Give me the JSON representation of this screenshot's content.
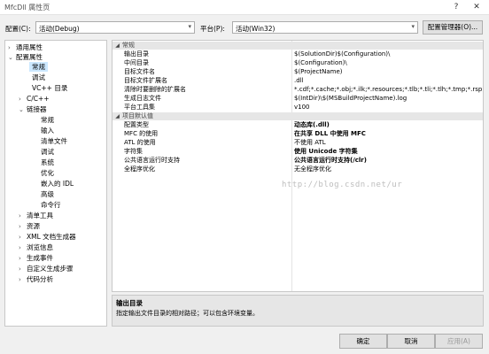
{
  "window": {
    "title": "MfcDll 属性页",
    "help_icon": "?",
    "close_icon": "✕"
  },
  "config_bar": {
    "config_label": "配置(C):",
    "config_value": "活动(Debug)",
    "platform_label": "平台(P):",
    "platform_value": "活动(Win32)",
    "manager_button": "配置管理器(O)..."
  },
  "tree": {
    "items": [
      {
        "label": "通用属性",
        "expander": "›"
      },
      {
        "label": "配置属性",
        "expander": "⌄"
      },
      {
        "label": "常规",
        "expander": ""
      },
      {
        "label": "调试",
        "expander": ""
      },
      {
        "label": "VC++ 目录",
        "expander": ""
      },
      {
        "label": "C/C++",
        "expander": "›"
      },
      {
        "label": "链接器",
        "expander": "⌄"
      },
      {
        "label": "常规",
        "expander": ""
      },
      {
        "label": "输入",
        "expander": ""
      },
      {
        "label": "清单文件",
        "expander": ""
      },
      {
        "label": "调试",
        "expander": ""
      },
      {
        "label": "系统",
        "expander": ""
      },
      {
        "label": "优化",
        "expander": ""
      },
      {
        "label": "嵌入的 IDL",
        "expander": ""
      },
      {
        "label": "高级",
        "expander": ""
      },
      {
        "label": "命令行",
        "expander": ""
      },
      {
        "label": "清单工具",
        "expander": "›"
      },
      {
        "label": "资源",
        "expander": "›"
      },
      {
        "label": "XML 文档生成器",
        "expander": "›"
      },
      {
        "label": "浏览信息",
        "expander": "›"
      },
      {
        "label": "生成事件",
        "expander": "›"
      },
      {
        "label": "自定义生成步骤",
        "expander": "›"
      },
      {
        "label": "代码分析",
        "expander": "›"
      }
    ]
  },
  "grid": {
    "sections": [
      {
        "title": "常规",
        "rows": [
          {
            "name": "输出目录",
            "value": "$(SolutionDir)$(Configuration)\\"
          },
          {
            "name": "中间目录",
            "value": "$(Configuration)\\"
          },
          {
            "name": "目标文件名",
            "value": "$(ProjectName)"
          },
          {
            "name": "目标文件扩展名",
            "value": ".dll"
          },
          {
            "name": "清除时要删除的扩展名",
            "value": "*.cdf;*.cache;*.obj;*.ilk;*.resources;*.tlb;*.tli;*.tlh;*.tmp;*.rsp;*.pgc"
          },
          {
            "name": "生成日志文件",
            "value": "$(IntDir)\\$(MSBuildProjectName).log"
          },
          {
            "name": "平台工具集",
            "value": "v100"
          }
        ]
      },
      {
        "title": "项目默认值",
        "rows": [
          {
            "name": "配置类型",
            "value": "动态库(.dll)"
          },
          {
            "name": "MFC 的使用",
            "value": "在共享 DLL 中使用 MFC"
          },
          {
            "name": "ATL 的使用",
            "value": "不使用 ATL"
          },
          {
            "name": "字符集",
            "value": "使用 Unicode 字符集"
          },
          {
            "name": "公共语言运行时支持",
            "value": "公共语言运行时支持(/clr)"
          },
          {
            "name": "全程序优化",
            "value": "无全程序优化"
          }
        ]
      }
    ],
    "watermark": "http://blog.csdn.net/ur"
  },
  "description": {
    "title": "输出目录",
    "text": "指定输出文件目录的相对路径；可以包含环境变量。"
  },
  "buttons": {
    "ok": "确定",
    "cancel": "取消",
    "apply": "应用(A)"
  }
}
